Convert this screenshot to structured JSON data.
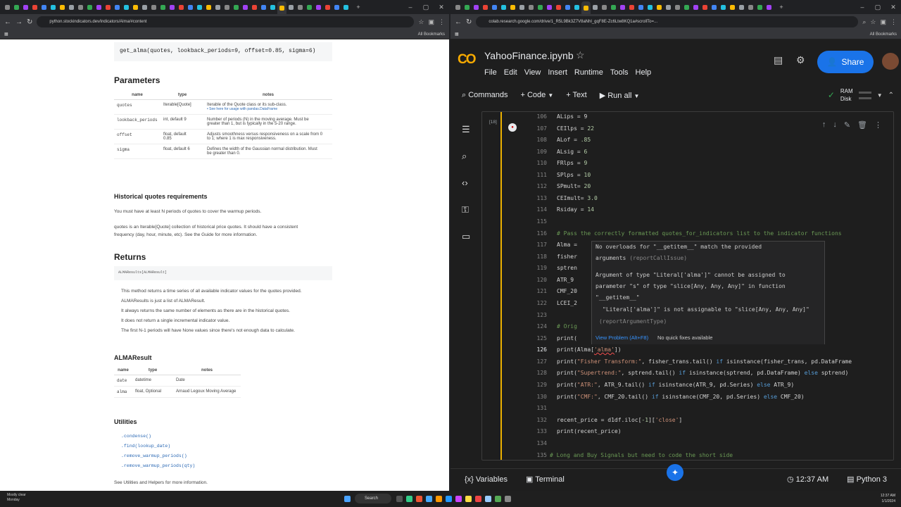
{
  "left_window": {
    "url": "python.stockindicators.dev/indicators/Alma/#content",
    "bookmarks_label": "All Bookmarks",
    "signature": "get_alma(quotes, lookback_periods=9, offset=0.85, sigma=6)",
    "parameters_title": "Parameters",
    "param_headers": [
      "name",
      "type",
      "notes"
    ],
    "params": [
      {
        "name": "quotes",
        "type": "Iterable[Quote]",
        "notes1": "Iterable of the Quote class or its sub-class.",
        "notes2": "• See here for usage with pandas.DataFrame"
      },
      {
        "name": "lookback_periods",
        "type": "int, default 9",
        "notes1": "Number of periods (N) in the moving average. Must be",
        "notes2": "greater than 1, but is typically in the 5-20 range."
      },
      {
        "name": "offset",
        "type": "float, default",
        "type2": "0.85",
        "notes1": "Adjusts smoothness versus responsiveness on a scale from 0",
        "notes2": "to 1; where 1 is max responsiveness."
      },
      {
        "name": "sigma",
        "type": "float, default 6",
        "notes1": "Defines the width of the Gaussian normal distribution. Must",
        "notes2": "be greater than 0."
      }
    ],
    "hist_title": "Historical quotes requirements",
    "hist_p1": "You must have at least N periods of quotes to cover the warmup periods.",
    "hist_p2a": "quotes is an Iterable[Quote] collection of historical price quotes. It should have a consistent",
    "hist_p2b": "frequency (day, hour, minute, etc). See the Guide for more information.",
    "returns_title": "Returns",
    "returns_code": "ALMAResults[ALMAResult]",
    "returns_bullets": [
      "This method returns a time series of all available indicator values for the quotes provided.",
      "ALMAResults is just a list of ALMAResult.",
      "It always returns the same number of elements as there are in the historical quotes.",
      "It does not return a single incremental indicator value.",
      "The first N-1 periods will have None values since there's not enough data to calculate."
    ],
    "result_title": "ALMAResult",
    "result_headers": [
      "name",
      "type",
      "notes"
    ],
    "result_rows": [
      {
        "name": "date",
        "type": "datetime",
        "notes": "Date"
      },
      {
        "name": "alma",
        "type": "float, Optional",
        "notes": "Arnaud Legoux Moving Average"
      }
    ],
    "utilities_title": "Utilities",
    "utilities": [
      ".condense()",
      ".find(lookup_date)",
      ".remove_warmup_periods()",
      ".remove_warmup_periods(qty)"
    ],
    "utilities_footer": "See Utilities and Helpers for more information."
  },
  "right_window": {
    "url": "colab.research.google.com/drive/1_R5L9Bk3Z7V8aNhl_gqF8E-Zc6Ltw8KQ1a#scrollTo=...",
    "notebook_title": "YahooFinance.ipynb",
    "menu": [
      "File",
      "Edit",
      "View",
      "Insert",
      "Runtime",
      "Tools",
      "Help"
    ],
    "share_label": "Share",
    "toolbar": {
      "commands": "Commands",
      "code": "+ Code",
      "text": "+ Text",
      "run_all": "Run all"
    },
    "ram_label": "RAM",
    "disk_label": "Disk",
    "exec_count": "[18]",
    "tooltip": {
      "l1": "No overloads for \"__getitem__\" match the provided",
      "l2": "arguments",
      "l2b": "(reportCallIssue)",
      "l3": "Argument of type \"Literal['alma']\" cannot be assigned to",
      "l4": "parameter \"s\" of type \"slice[Any, Any, Any]\" in function",
      "l5": "\"__getitem__\"",
      "l6": "\"Literal['alma']\" is not assignable to \"slice[Any, Any, Any]\"",
      "l7": "(reportArgumentType)",
      "view_problem": "View Problem (Alt+F8)",
      "no_fixes": "No quick fixes available"
    },
    "bottom": {
      "variables": "Variables",
      "terminal": "Terminal",
      "time": "12:37 AM",
      "runtime": "Python 3"
    }
  },
  "taskbar": {
    "weather": "Mostly clear",
    "weather2": "Monday",
    "search": "Search",
    "time": "12:37 AM",
    "date": "1/1/2024"
  }
}
